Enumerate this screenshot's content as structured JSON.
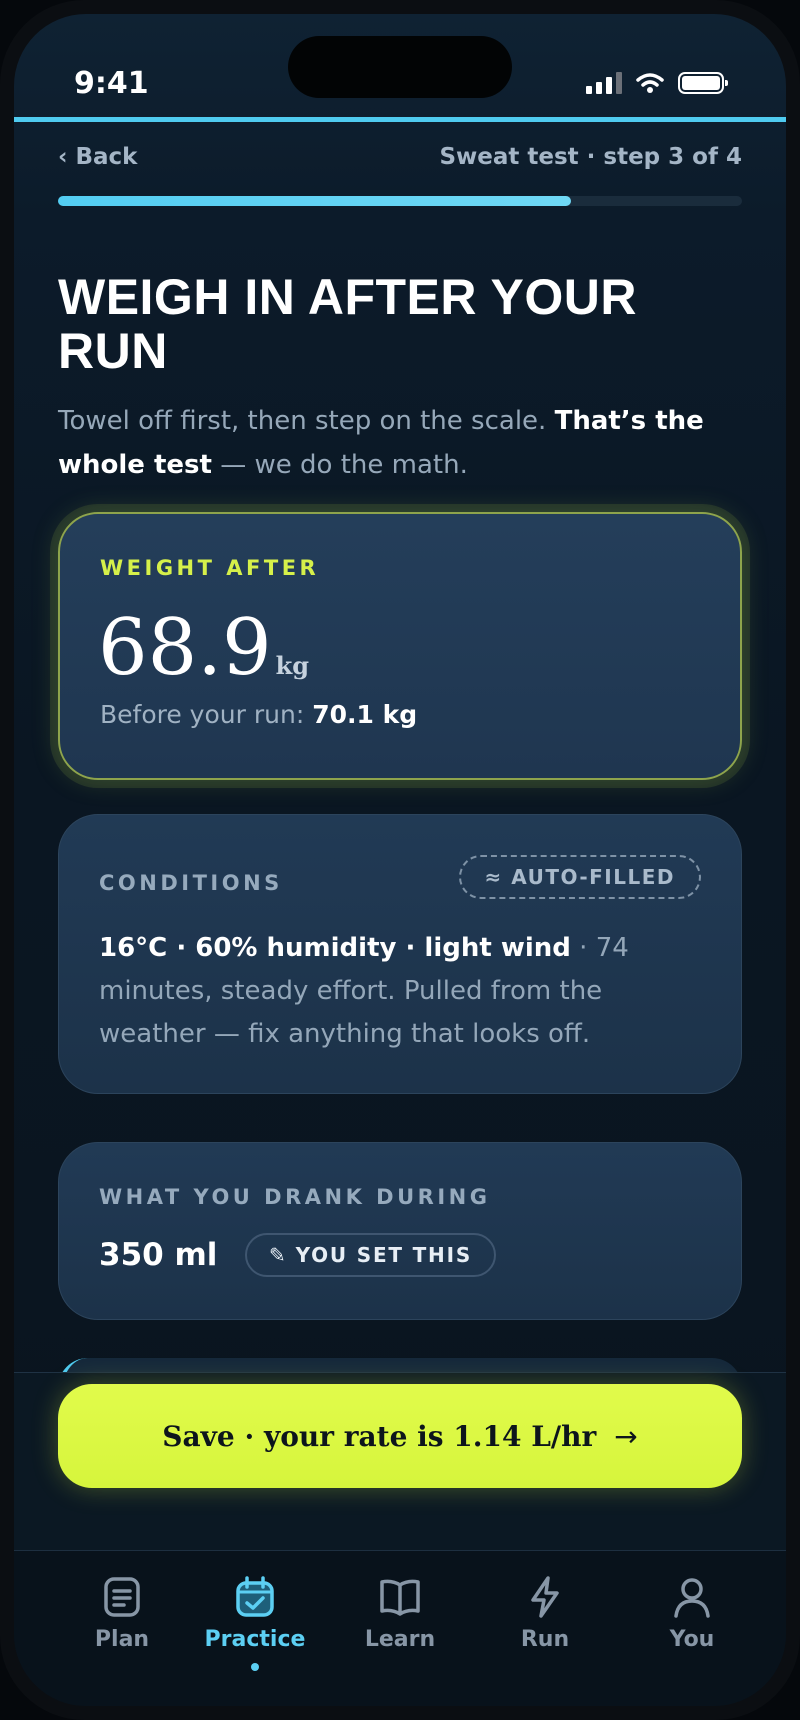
{
  "status_bar": {
    "time": "9:41"
  },
  "header": {
    "back_label": "‹ Back",
    "step_text": "Sweat test · step 3 of 4",
    "progress": 0.75
  },
  "title": "WEIGH IN AFTER YOUR RUN",
  "subtitle": {
    "part1": "Towel off first, then step on the scale. ",
    "bold": "That’s the whole test",
    "part2": " — we do the math."
  },
  "weight_card": {
    "label": "WEIGHT AFTER",
    "value": "68.9",
    "unit": "kg",
    "before_label": "Before your run: ",
    "before_value": "70.1 kg"
  },
  "conditions_card": {
    "label": "CONDITIONS",
    "badge": "≈ AUTO-FILLED",
    "bold_text": "16°C · 60% humidity · light wind",
    "rest_text": " · 74 minutes, steady effort. Pulled from the weather — fix anything that looks off."
  },
  "drank_card": {
    "label": "WHAT YOU DRANK DURING",
    "value": "350 ml",
    "badge_icon": "✎",
    "badge": "YOU SET THIS"
  },
  "cta": {
    "label": "Save · your rate is 1.14 L/hr",
    "arrow": "→"
  },
  "tabs": [
    {
      "label": "Plan",
      "icon": "document-icon",
      "active": false
    },
    {
      "label": "Practice",
      "icon": "calendar-check-icon",
      "active": true
    },
    {
      "label": "Learn",
      "icon": "book-icon",
      "active": false
    },
    {
      "label": "Run",
      "icon": "lightning-icon",
      "active": false
    },
    {
      "label": "You",
      "icon": "person-icon",
      "active": false
    }
  ],
  "colors": {
    "accent_cyan": "#4fcbf0",
    "accent_lime": "#d6f53c",
    "background": "#0a1622"
  }
}
